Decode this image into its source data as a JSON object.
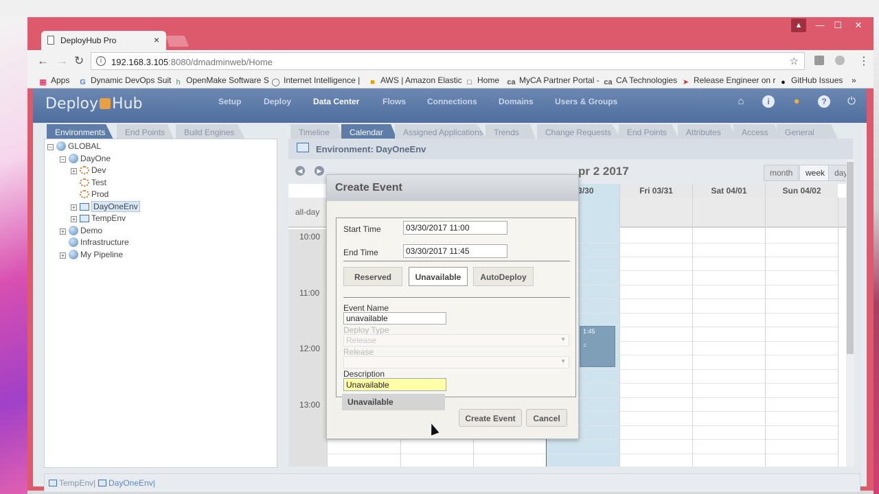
{
  "browser": {
    "tab_title": "DeployHub Pro",
    "tab_close": "×",
    "url_host": "192.168.3.105",
    "url_path": ":8080/dmadminweb/Home",
    "window_controls": {
      "minimize": "—",
      "maximize": "☐",
      "close": "✕"
    },
    "bookmarks": [
      {
        "label": "Apps",
        "icon": "apps-grid-icon"
      },
      {
        "label": "Dynamic DevOps Suit",
        "icon": "google-icon"
      },
      {
        "label": "OpenMake Software S",
        "icon": "openmake-icon"
      },
      {
        "label": "Internet Intelligence |",
        "icon": "circle-icon"
      },
      {
        "label": "AWS | Amazon Elastic",
        "icon": "aws-icon"
      },
      {
        "label": "Home",
        "icon": "page-icon"
      },
      {
        "label": "MyCA Partner Portal -",
        "icon": "ca-icon"
      },
      {
        "label": "CA Technologies",
        "icon": "ca-icon"
      },
      {
        "label": "Release Engineer on r",
        "icon": "rocket-icon"
      },
      {
        "label": "GitHub Issues",
        "icon": "github-icon"
      }
    ],
    "more_bookmarks": "»"
  },
  "app": {
    "logo_left": "Deploy",
    "logo_right": "Hub",
    "nav": [
      "Setup",
      "Deploy",
      "Data Center",
      "Flows",
      "Connections",
      "Domains",
      "Users & Groups"
    ],
    "nav_active": "Data Center",
    "left_tabs": [
      "Environments",
      "End Points",
      "Build Engines"
    ],
    "right_tabs": [
      "Timeline",
      "Calendar",
      "Assigned Applications",
      "Trends",
      "Change Requests",
      "End Points",
      "Attributes",
      "Access",
      "General"
    ],
    "tree": [
      "GLOBAL",
      "DayOne",
      "Dev",
      "Test",
      "Prod",
      "DayOneEnv",
      "TempEnv",
      "Demo",
      "Infrastructure",
      "My Pipeline"
    ],
    "env_title": "Environment: DayOneEnv",
    "calendar": {
      "date_range": "pr 2 2017",
      "views": [
        "month",
        "week",
        "day"
      ],
      "active_view": "week",
      "day_headers": [
        "03/30",
        "Fri 03/31",
        "Sat 04/01",
        "Sun 04/02"
      ],
      "allday_label": "all-day",
      "hours": [
        "10:00",
        "11:00",
        "12:00",
        "13:00"
      ],
      "event_text": "1:45",
      "event_marker": "="
    },
    "breadcrumbs": [
      "TempEnv|",
      "DayOneEnv|"
    ]
  },
  "dialog": {
    "title": "Create Event",
    "start_label": "Start Time",
    "start_value": "03/30/2017 11:00",
    "end_label": "End Time",
    "end_value": "03/30/2017 11:45",
    "types": [
      "Reserved",
      "Unavailable",
      "AutoDeploy"
    ],
    "active_type": "Unavailable",
    "event_name_label": "Event Name",
    "event_name_value": "unavailable",
    "deploy_type_label": "Deploy Type",
    "deploy_type_value": "Release",
    "release_label": "Release",
    "release_value": "",
    "description_label": "Description",
    "description_value": "Unavailable",
    "suggestion": "Unavailable",
    "create_label": "Create Event",
    "cancel_label": "Cancel"
  }
}
